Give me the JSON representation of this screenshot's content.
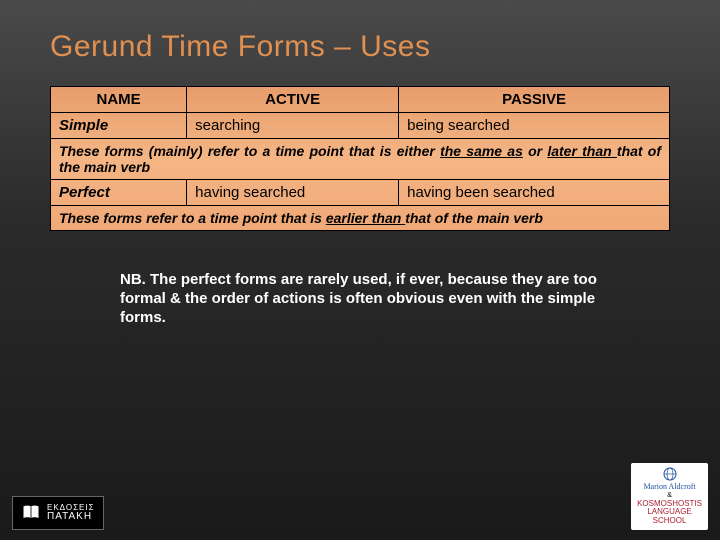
{
  "title": "Gerund Time Forms – Uses",
  "headers": {
    "name": "NAME",
    "active": "ACTIVE",
    "passive": "PASSIVE"
  },
  "rows": {
    "simple": {
      "name": "Simple",
      "active": "searching",
      "passive": "being searched"
    },
    "perfect": {
      "name": "Perfect",
      "active": "having searched",
      "passive": "having been searched"
    }
  },
  "note1": {
    "pre": "These forms (mainly) refer to a time point that is either ",
    "u1": "the same as",
    "mid": " or ",
    "u2": "later than ",
    "post": "that of the main verb"
  },
  "note2": {
    "pre": "These forms refer to a time point that is ",
    "u1": "earlier than ",
    "post": "that of the main verb"
  },
  "nb": "NB. The perfect forms are rarely used, if ever, because they are too formal & the order of actions is often obvious even with the simple forms.",
  "logos": {
    "left_small": "ΕΚΔΟΣΕΙΣ",
    "left_big": "ΠΑΤΑΚΗ",
    "right_top": "Marion Aldcroft",
    "right_amp": "&",
    "right_mid": "KOSMOSHOSTIS",
    "right_lang": "LANGUAGE",
    "right_school": "SCHOOL"
  }
}
